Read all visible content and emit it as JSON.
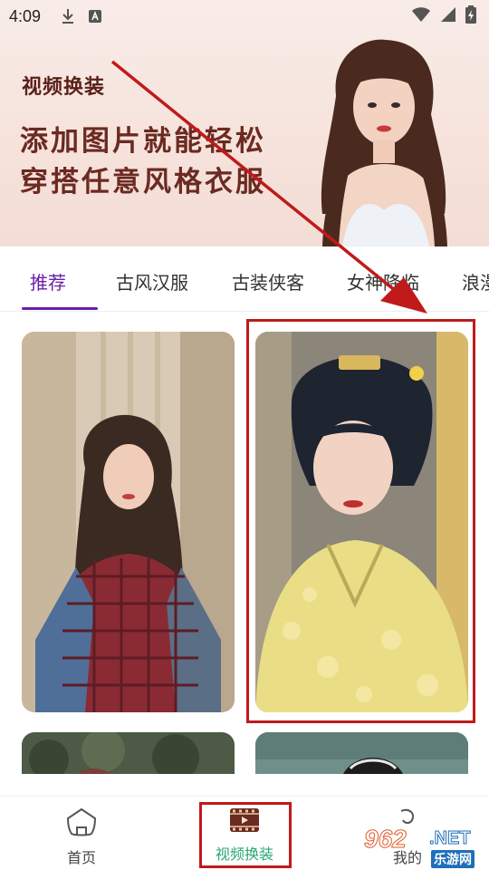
{
  "status": {
    "time": "4:09"
  },
  "banner": {
    "title": "视频换装",
    "slogan_line1": "添加图片就能轻松",
    "slogan_line2": "穿搭任意风格衣服"
  },
  "tabs": [
    {
      "label": "推荐",
      "active": true
    },
    {
      "label": "古风汉服",
      "active": false
    },
    {
      "label": "古装侠客",
      "active": false
    },
    {
      "label": "女神降临",
      "active": false
    },
    {
      "label": "浪漫",
      "active": false
    }
  ],
  "bottom_nav": [
    {
      "label": "首页",
      "icon": "home-icon",
      "active": false
    },
    {
      "label": "视频换装",
      "icon": "film-icon",
      "active": true
    },
    {
      "label": "我的",
      "icon": "profile-icon",
      "active": false
    }
  ],
  "watermark": {
    "number": "962",
    "net": ".NET",
    "sub": "乐游网"
  },
  "colors": {
    "accent": "#6a1ea8",
    "nav_active": "#2aa872",
    "annotation": "#c01a1a"
  }
}
